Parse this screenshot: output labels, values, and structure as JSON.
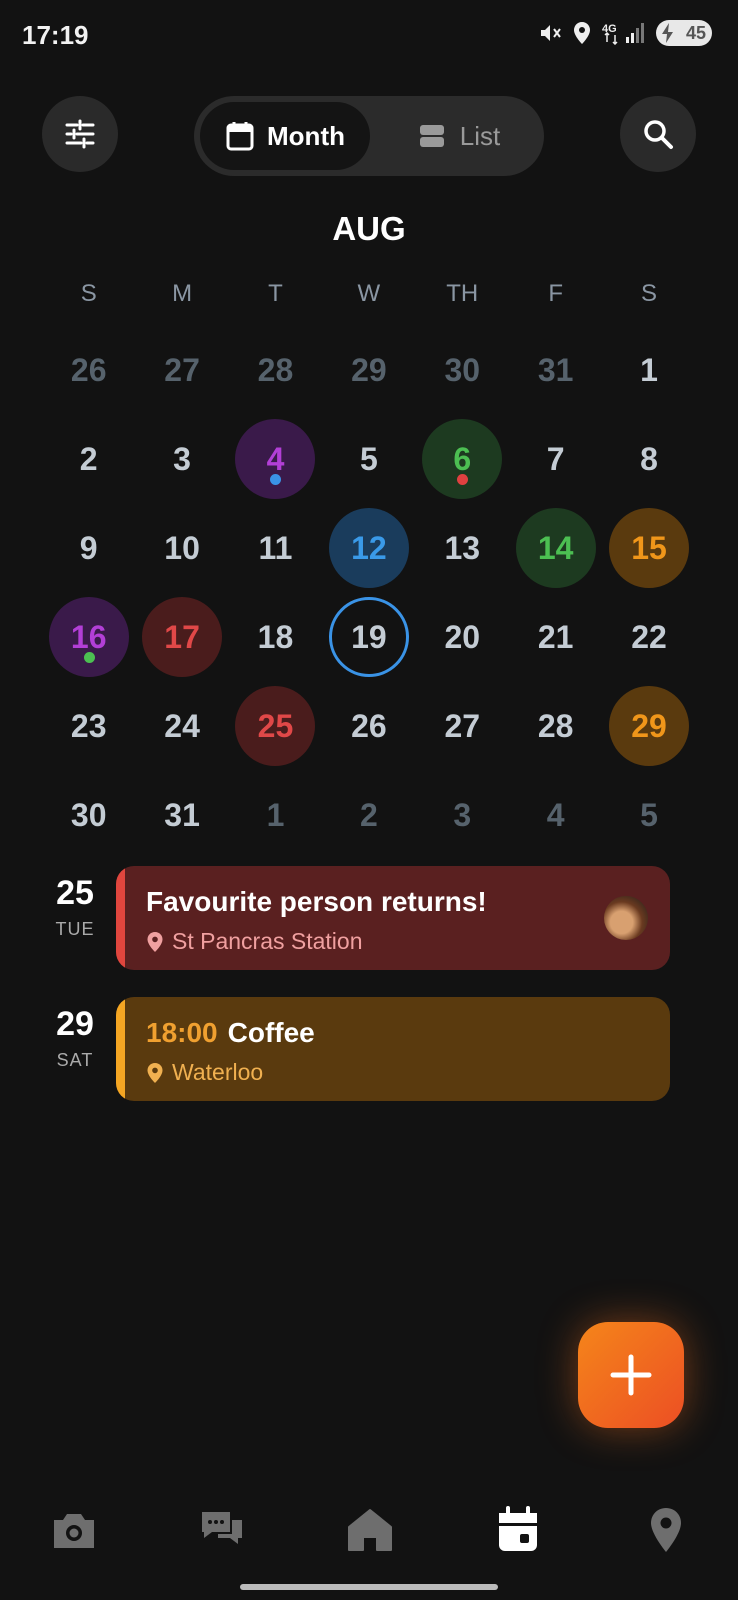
{
  "status_bar": {
    "time": "17:19",
    "battery": "45"
  },
  "toolbar": {
    "month_label": "Month",
    "list_label": "List"
  },
  "calendar": {
    "month_title": "AUG",
    "weekdays": [
      "S",
      "M",
      "T",
      "W",
      "TH",
      "F",
      "S"
    ],
    "weeks": [
      [
        "26",
        "27",
        "28",
        "29",
        "30",
        "31",
        "1"
      ],
      [
        "2",
        "3",
        "4",
        "5",
        "6",
        "7",
        "8"
      ],
      [
        "9",
        "10",
        "11",
        "12",
        "13",
        "14",
        "15"
      ],
      [
        "16",
        "17",
        "18",
        "19",
        "20",
        "21",
        "22"
      ],
      [
        "23",
        "24",
        "25",
        "26",
        "27",
        "28",
        "29"
      ],
      [
        "30",
        "31",
        "1",
        "2",
        "3",
        "4",
        "5"
      ]
    ]
  },
  "events": [
    {
      "day": "25",
      "weekday": "TUE",
      "title": "Favourite person returns!",
      "location": "St Pancras Station",
      "color": "#5a2020",
      "accent": "#e0463e"
    },
    {
      "day": "29",
      "weekday": "SAT",
      "time": "18:00",
      "title": "Coffee",
      "location": "Waterloo",
      "color": "#5a3a0e",
      "accent": "#f5a623"
    }
  ],
  "colors": {
    "background": "#121212",
    "accent": "#f27a1e",
    "today_ring": "#3a93e6"
  },
  "icons": {
    "filter": "sliders-icon",
    "search": "search-icon",
    "month": "calendar-icon",
    "list": "list-icon",
    "add": "plus-icon",
    "nav": [
      "camera-icon",
      "chat-icon",
      "home-icon",
      "calendar-icon",
      "location-pin-icon"
    ]
  }
}
